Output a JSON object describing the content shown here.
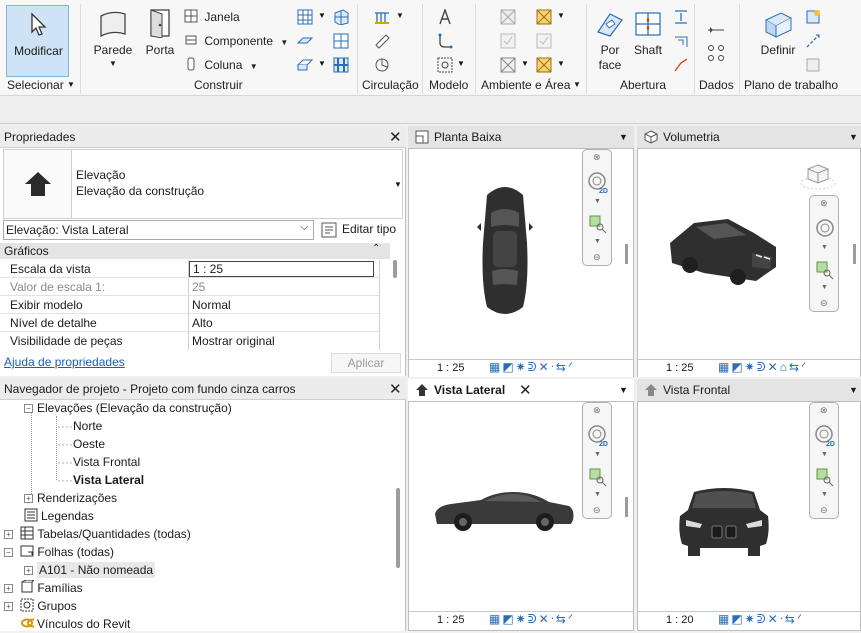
{
  "ribbon": {
    "select": {
      "modify_label": "Modificar",
      "group_label": "Selecionar"
    },
    "construct": {
      "wall_label": "Parede",
      "door_label": "Porta",
      "window_label": "Janela",
      "component_label": "Componente",
      "column_label": "Coluna",
      "group_label": "Construir"
    },
    "circulation": {
      "group_label": "Circulação"
    },
    "model": {
      "group_label": "Modelo"
    },
    "room_area": {
      "group_label": "Ambiente e Área"
    },
    "opening": {
      "by_face_line1": "Por",
      "by_face_line2": "face",
      "shaft_label": "Shaft",
      "group_label": "Abertura"
    },
    "datum": {
      "group_label": "Dados"
    },
    "work_plane": {
      "set_label": "Definir",
      "group_label": "Plano de trabalho"
    }
  },
  "properties": {
    "title": "Propriedades",
    "type_line1": "Elevação",
    "type_line2": "Elevação da construção",
    "selector_value": "Elevação: Vista Lateral",
    "edit_type_label": "Editar tipo",
    "section_label": "Gráficos",
    "rows": [
      {
        "name": "Escala da vista",
        "value": "1 : 25",
        "greyed": false
      },
      {
        "name": "Valor de escala    1:",
        "value": "25",
        "greyed": true
      },
      {
        "name": "Exibir modelo",
        "value": "Normal",
        "greyed": false
      },
      {
        "name": "Nível de detalhe",
        "value": "Alto",
        "greyed": false
      },
      {
        "name": "Visibilidade de peças",
        "value": "Mostrar original",
        "greyed": false
      }
    ],
    "help_link": "Ajuda de propriedades",
    "apply_label": "Aplicar"
  },
  "browser": {
    "title": "Navegador de projeto - Projeto com fundo cinza carros",
    "elevations_label": "Elevações (Elevação da construção)",
    "elev_items": [
      "Norte",
      "Oeste",
      "Vista Frontal",
      "Vista Lateral"
    ],
    "renderings_label": "Renderizações",
    "legends_label": "Legendas",
    "schedules_label": "Tabelas/Quantidades (todas)",
    "sheets_label": "Folhas (todas)",
    "sheet_item": "A101 - Não nomeada",
    "families_label": "Famílias",
    "groups_label": "Grupos",
    "links_label": "Vínculos do Revit"
  },
  "views": {
    "floor_plan": {
      "title": "Planta Baixa",
      "scale": "1 : 25"
    },
    "threed": {
      "title": "Volumetria",
      "scale": "1 : 25"
    },
    "side": {
      "title": "Vista Lateral",
      "scale": "1 : 25"
    },
    "front": {
      "title": "Vista Frontal",
      "scale": "1 : 20"
    }
  },
  "colors": {
    "accent": "#cfe3f7",
    "accent_border": "#84b3df",
    "link": "#1a5fb4",
    "car": "#2f2f2f"
  }
}
